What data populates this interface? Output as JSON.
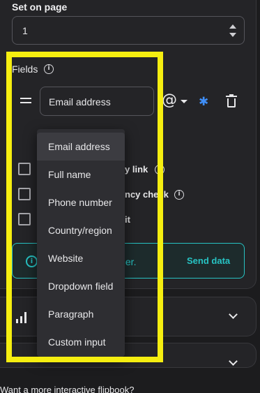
{
  "set_on_page": {
    "label": "Set on page",
    "value": "1"
  },
  "fields": {
    "label": "Fields",
    "info_icon": "info-icon",
    "row": {
      "drag_icon": "drag-handle-icon",
      "selected_type": "Email address",
      "format_icon": "at-sign-icon",
      "format_glyph": "@",
      "required_icon": "asterisk-icon",
      "required_glyph": "✱",
      "delete_icon": "trash-icon"
    },
    "options": [
      {
        "visible_text": "y link",
        "has_info": true
      },
      {
        "visible_text": "ncy check",
        "has_info": true
      },
      {
        "visible_text": "it",
        "has_info": false
      }
    ],
    "dropdown": {
      "items": [
        "Email address",
        "Full name",
        "Phone number",
        "Country/region",
        "Website",
        "Dropdown field",
        "Paragraph",
        "Custom input"
      ],
      "selected_index": 0
    }
  },
  "banner": {
    "text": "pier.",
    "button": "Send data",
    "color": "#27c4c4"
  },
  "accordions": [
    {
      "icon": "bar-chart-icon",
      "expanded": false
    },
    {
      "icon": "unknown-icon",
      "expanded": false
    }
  ],
  "footer": {
    "text": "Want a more interactive flipbook?"
  },
  "highlight_color": "#f5ee10",
  "accent_color": "#3f8ef7"
}
